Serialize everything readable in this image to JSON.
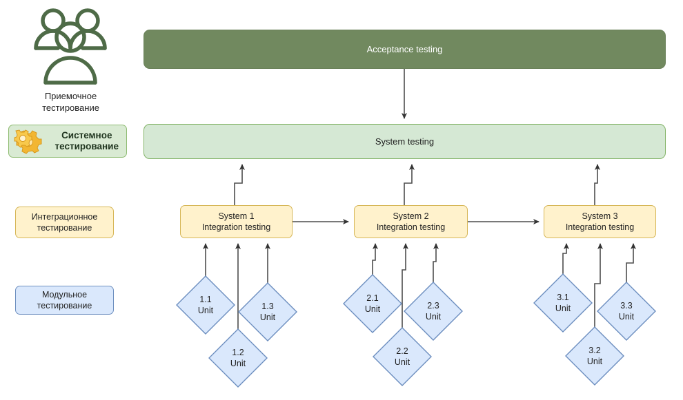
{
  "legend": {
    "acceptance": {
      "icon": "people-group-icon",
      "label_line1": "Приемочное",
      "label_line2": "тестирование"
    },
    "system": {
      "icon": "gear-icon",
      "label_line1": "Системное",
      "label_line2": "тестирование"
    },
    "integration": {
      "label_line1": "Интеграционное",
      "label_line2": "тестирование"
    },
    "unit": {
      "label_line1": "Модульное",
      "label_line2": "тестирование"
    }
  },
  "levels": {
    "acceptance_bar": "Acceptance testing",
    "system_bar": "System testing"
  },
  "systems": [
    {
      "title": "System 1",
      "subtitle": "Integration testing",
      "units": [
        {
          "id": "1.1",
          "kind": "Unit"
        },
        {
          "id": "1.2",
          "kind": "Unit"
        },
        {
          "id": "1.3",
          "kind": "Unit"
        }
      ]
    },
    {
      "title": "System 2",
      "subtitle": "Integration testing",
      "units": [
        {
          "id": "2.1",
          "kind": "Unit"
        },
        {
          "id": "2.2",
          "kind": "Unit"
        },
        {
          "id": "2.3",
          "kind": "Unit"
        }
      ]
    },
    {
      "title": "System 3",
      "subtitle": "Integration testing",
      "units": [
        {
          "id": "3.1",
          "kind": "Unit"
        },
        {
          "id": "3.2",
          "kind": "Unit"
        },
        {
          "id": "3.3",
          "kind": "Unit"
        }
      ]
    }
  ],
  "colors": {
    "acceptance_fill": "#71895f",
    "acceptance_text": "#ffffff",
    "system_fill": "#d5e8d4",
    "system_stroke": "#82b366",
    "integration_fill": "#fff2cc",
    "integration_stroke": "#d6b656",
    "unit_fill": "#dae8fc",
    "unit_stroke": "#6c8ebf",
    "icon_green": "#4e6b47",
    "edge": "#4d4d4d"
  }
}
